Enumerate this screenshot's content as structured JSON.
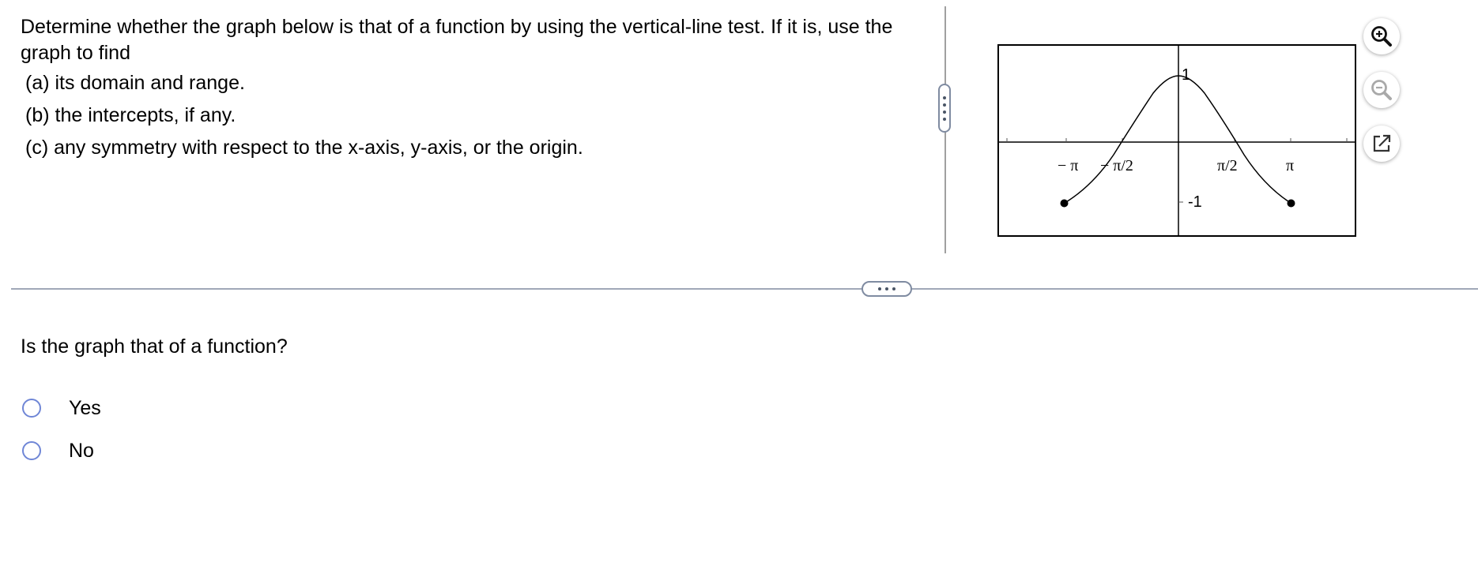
{
  "question": {
    "text": "Determine whether the graph below is that of a function by using the vertical-line test.  If it is, use the graph to find",
    "parts": [
      "(a) its domain and range.",
      "(b) the intercepts, if any.",
      "(c) any symmetry with respect to the x-axis, y-axis, or the origin."
    ]
  },
  "graph": {
    "tick_labels": {
      "neg_pi": "− π",
      "neg_pi_half": "− π/2",
      "pi_half": "π/2",
      "pi": "π",
      "y_max": "1",
      "y_min": "-1"
    }
  },
  "toolbar": {
    "zoom_in_icon": "zoom-in-icon",
    "zoom_out_icon": "zoom-out-icon",
    "popout_icon": "external-link-icon"
  },
  "prompt": "Is the graph that of a function?",
  "options": [
    {
      "label": "Yes"
    },
    {
      "label": "No"
    }
  ],
  "colors": {
    "radio": "#6f86d6",
    "divider": "#a0a8b8",
    "handle_border": "#7f8ba1"
  }
}
